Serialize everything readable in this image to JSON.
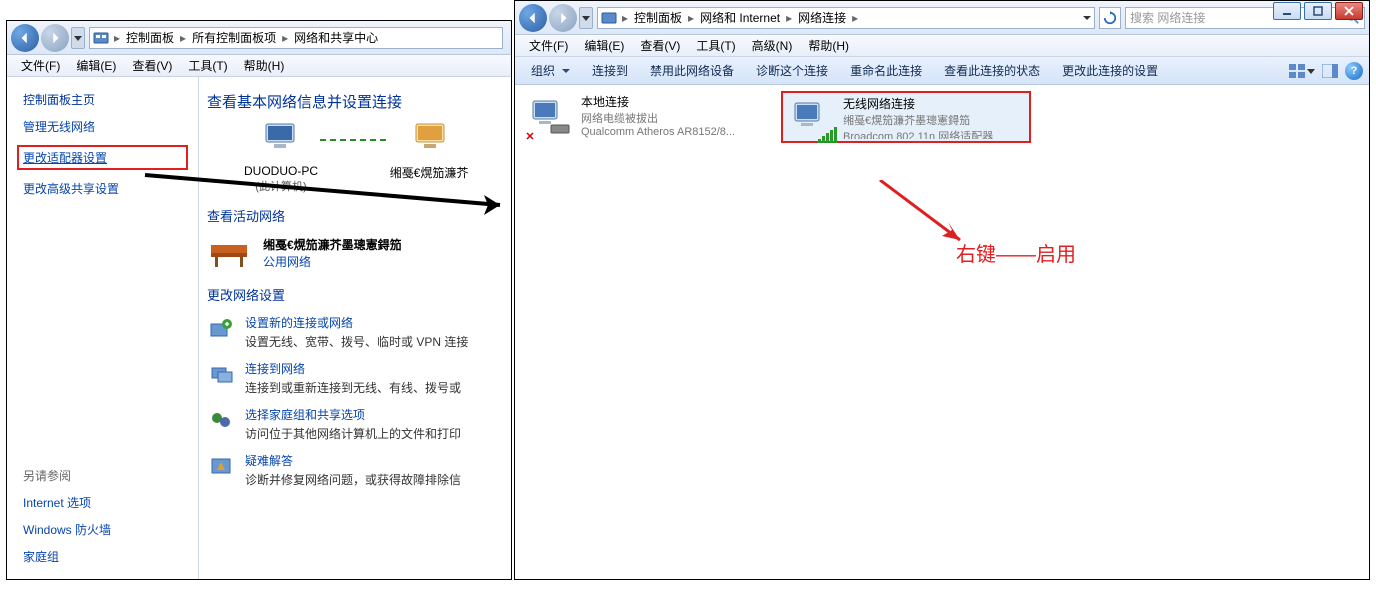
{
  "left": {
    "breadcrumb": [
      "控制面板",
      "所有控制面板项",
      "网络和共享中心"
    ],
    "menus": [
      "文件(F)",
      "编辑(E)",
      "查看(V)",
      "工具(T)",
      "帮助(H)"
    ],
    "sidebar": {
      "title": "控制面板主页",
      "links": [
        "管理无线网络",
        "更改适配器设置",
        "更改高级共享设置"
      ],
      "see_also_title": "另请参阅",
      "see_also": [
        "Internet 选项",
        "Windows 防火墙",
        "家庭组"
      ]
    },
    "main": {
      "title": "查看基本网络信息并设置连接",
      "pc_name": "DUODUO-PC",
      "pc_sub": "(此计算机)",
      "net_name_trunc": "缃戞€熀笳濂芥",
      "active_title": "查看活动网络",
      "active_net_name": "缃戞€熀笳濂芥墨璁憲鍀笳",
      "active_net_type": "公用网络",
      "settings_title": "更改网络设置",
      "settings": [
        {
          "link": "设置新的连接或网络",
          "desc": "设置无线、宽带、拨号、临时或 VPN 连接"
        },
        {
          "link": "连接到网络",
          "desc": "连接到或重新连接到无线、有线、拨号或"
        },
        {
          "link": "选择家庭组和共享选项",
          "desc": "访问位于其他网络计算机上的文件和打印"
        },
        {
          "link": "疑难解答",
          "desc": "诊断并修复网络问题，或获得故障排除信"
        }
      ]
    }
  },
  "right": {
    "breadcrumb": [
      "控制面板",
      "网络和 Internet",
      "网络连接"
    ],
    "search_placeholder": "搜索 网络连接",
    "menus": [
      "文件(F)",
      "编辑(E)",
      "查看(V)",
      "工具(T)",
      "高级(N)",
      "帮助(H)"
    ],
    "toolbar": [
      "组织",
      "连接到",
      "禁用此网络设备",
      "诊断这个连接",
      "重命名此连接",
      "查看此连接的状态",
      "更改此连接的设置"
    ],
    "connections": [
      {
        "title": "本地连接",
        "line2": "网络电缆被拔出",
        "line3": "Qualcomm Atheros AR8152/8...",
        "disabled": true
      },
      {
        "title": "无线网络连接",
        "line2": "缃戞€熀笳濂芥墨璁憲鍀笳",
        "line3": "Broadcom 802.11n 网络适配器",
        "selected": true
      }
    ]
  },
  "annotation": "右键——启用"
}
